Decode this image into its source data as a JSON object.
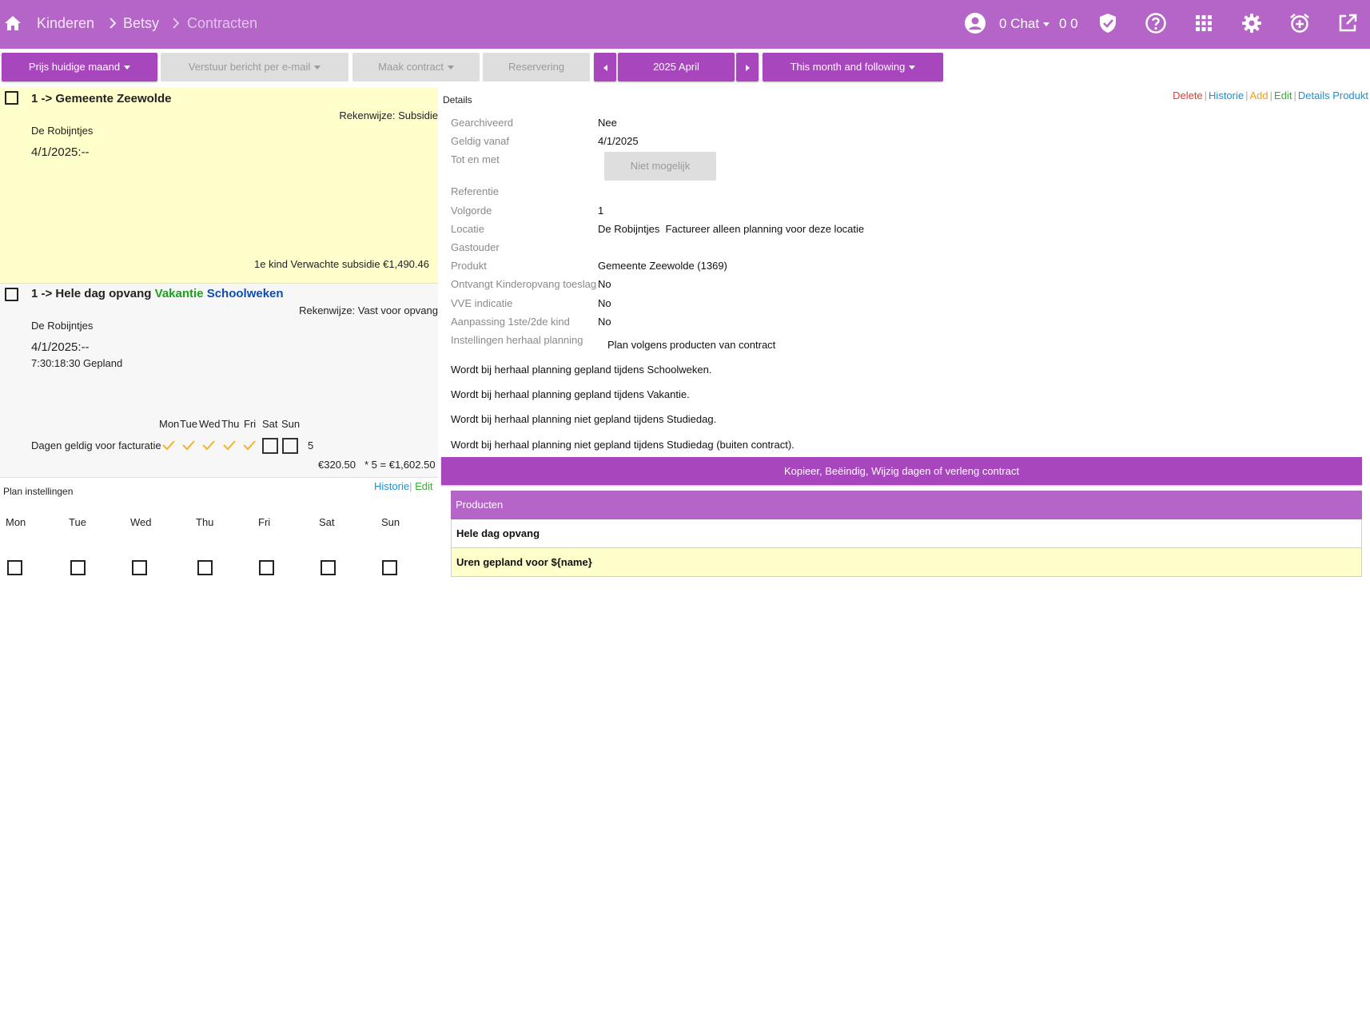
{
  "nav": {
    "breadcrumbs": [
      "Kinderen",
      "Betsy",
      "Contracten"
    ],
    "chat_label": "0 Chat",
    "counts": "0 0"
  },
  "toolbar": {
    "price_label": "Prijs huidige maand",
    "email_label": "Verstuur bericht per e-mail",
    "contract_label": "Maak contract",
    "reservation_label": "Reservering",
    "month_label": "2025 April",
    "range_label": "This month and following"
  },
  "contracts": [
    {
      "title": "1 -> Gemeente Zeewolde",
      "rekenwijze": "Rekenwijze: Subsidie",
      "location": "De Robijntjes",
      "date": "4/1/2025:--",
      "subsidy": "1e kind Verwachte subsidie €1,490.46"
    },
    {
      "title_prefix": "1 -> Hele dag opvang",
      "tag_vakantie": "Vakantie",
      "tag_schoolweken": "Schoolweken",
      "rekenwijze": "Rekenwijze: Vast voor opvang",
      "location": "De Robijntjes",
      "date": "4/1/2025:--",
      "time": "7:30:18:30 Gepland",
      "day_headers": [
        "Mon",
        "Tue",
        "Wed",
        "Thu",
        "Fri",
        "Sat",
        "Sun"
      ],
      "days_label": "Dagen geldig voor facturatie",
      "days_checked": [
        true,
        true,
        true,
        true,
        true,
        false,
        false
      ],
      "day_count": "5",
      "unit_price": "€320.50",
      "total": "* 5 = €1,602.50"
    }
  ],
  "plan": {
    "title": "Plan instellingen",
    "historie": "Historie",
    "edit": "Edit",
    "days": [
      "Mon",
      "Tue",
      "Wed",
      "Thu",
      "Fri",
      "Sat",
      "Sun"
    ]
  },
  "details": {
    "title": "Details",
    "links": {
      "delete": "Delete",
      "historie": "Historie",
      "add": "Add",
      "edit": "Edit",
      "details_produkt": "Details Produkt"
    },
    "rows": {
      "gearchiveerd": {
        "label": "Gearchiveerd",
        "value": "Nee"
      },
      "geldig_vanaf": {
        "label": "Geldig vanaf",
        "value": "4/1/2025"
      },
      "tot_en_met": {
        "label": "Tot en met",
        "button": "Niet mogelijk"
      },
      "referentie": {
        "label": "Referentie",
        "value": ""
      },
      "volgorde": {
        "label": "Volgorde",
        "value": "1"
      },
      "locatie": {
        "label": "Locatie",
        "value": "De Robijntjes  Factureer alleen planning voor deze locatie"
      },
      "gastouder": {
        "label": "Gastouder",
        "value": ""
      },
      "produkt": {
        "label": "Produkt",
        "value": "Gemeente Zeewolde (1369)"
      },
      "toeslag": {
        "label": "Ontvangt Kinderopvang toeslag",
        "value": "No"
      },
      "vve": {
        "label": "VVE indicatie",
        "value": "No"
      },
      "aanpassing": {
        "label": "Aanpassing 1ste/2de kind",
        "value": "No"
      },
      "herhaal": {
        "label": "Instellingen herhaal planning",
        "value": "Plan volgens producten van contract"
      }
    },
    "notes": [
      "Wordt bij herhaal planning gepland tijdens Schoolweken.",
      "Wordt bij herhaal planning gepland tijdens Vakantie.",
      "Wordt bij herhaal planning niet gepland tijdens Studiedag.",
      "Wordt bij herhaal planning niet gepland tijdens Studiedag (buiten contract)."
    ],
    "action_button": "Kopieer, Beëindig, Wijzig dagen of verleng contract"
  },
  "producten": {
    "header": "Producten",
    "rows": [
      "Hele dag opvang",
      "Uren gepland voor ${name}"
    ]
  },
  "colors": {
    "header_bg": "#b565c8",
    "button_bg": "#a746bd",
    "card_highlight": "#ffffcc",
    "check_color": "#f0b429"
  }
}
